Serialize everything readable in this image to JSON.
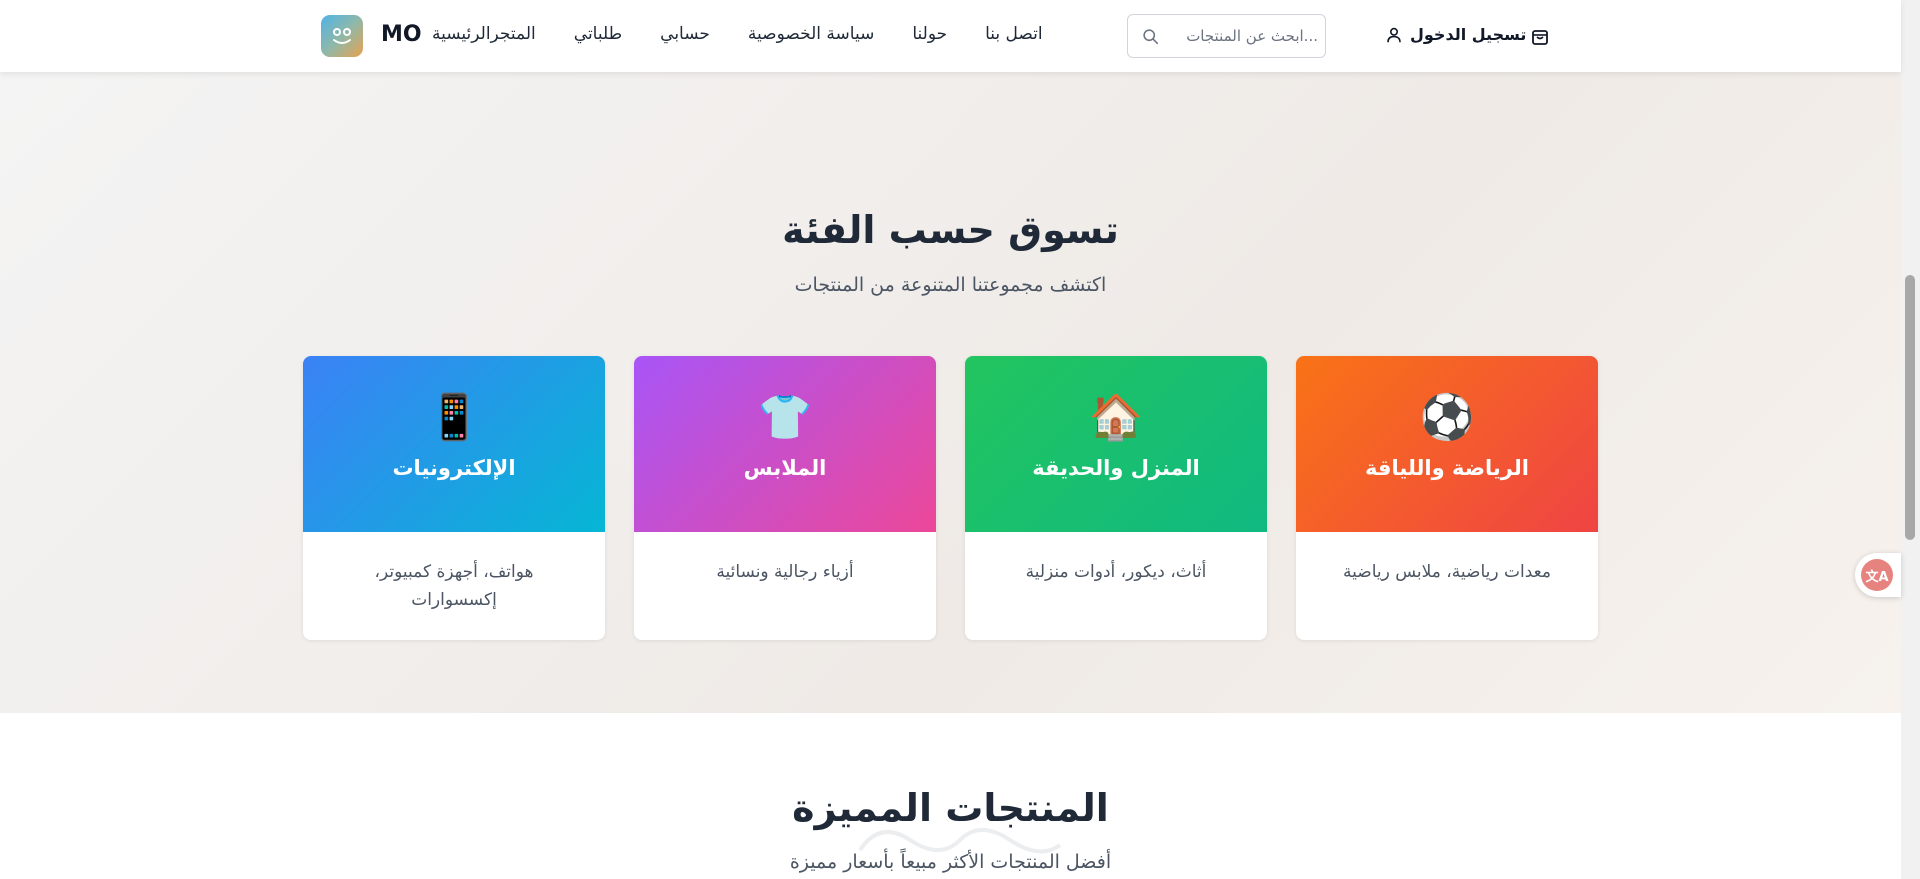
{
  "header": {
    "logo_text": "MO",
    "nav": [
      "المتجرالرئيسية",
      "طلباتي",
      "حسابي",
      "سياسة الخصوصية",
      "حولنا",
      "اتصل بنا"
    ],
    "search_placeholder": "...ابحث عن المنتجات",
    "login_label": "تسجيل الدخول",
    "icons": {
      "logo": "people-icon",
      "search": "search-icon",
      "user": "user-icon",
      "cart": "shopping-bag-icon"
    }
  },
  "categories_section": {
    "title": "تسوق حسب الفئة",
    "subtitle": "اكتشف مجموعتنا المتنوعة من المنتجات",
    "cards": [
      {
        "icon": "📱",
        "icon_name": "phone-icon",
        "title": "الإلكترونيات",
        "desc": "هواتف، أجهزة كمبيوتر، إكسسوارات",
        "gradient": [
          "#3b82f6",
          "#06b6d4"
        ]
      },
      {
        "icon": "👕",
        "icon_name": "shirt-icon",
        "title": "الملابس",
        "desc": "أزياء رجالية ونسائية",
        "gradient": [
          "#a855f7",
          "#ec4899"
        ]
      },
      {
        "icon": "🏠",
        "icon_name": "house-icon",
        "title": "المنزل والحديقة",
        "desc": "أثاث، ديكور، أدوات منزلية",
        "gradient": [
          "#22c55e",
          "#10b981"
        ]
      },
      {
        "icon": "⚽",
        "icon_name": "soccer-ball-icon",
        "title": "الرياضة واللياقة",
        "desc": "معدات رياضية، ملابس رياضية",
        "gradient": [
          "#f97316",
          "#ef4444"
        ]
      }
    ]
  },
  "featured_section": {
    "title": "المنتجات المميزة",
    "subtitle": "أفضل المنتجات الأكثر مبيعاً بأسعار مميزة"
  },
  "colors": {
    "accent": "#111827",
    "page_bg": "#f4f1ee"
  }
}
